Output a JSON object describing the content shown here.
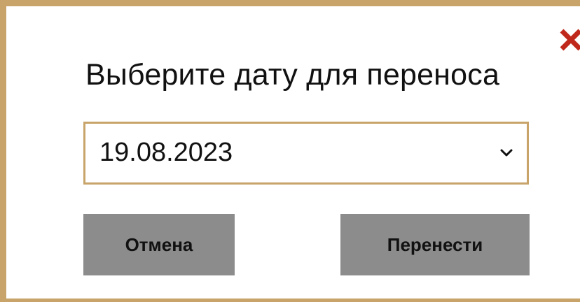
{
  "dialog": {
    "title": "Выберите дату для переноса",
    "close_icon": "close-x-icon",
    "close_color": "#c0281c",
    "date_select": {
      "selected_value": "19.08.2023",
      "dropdown_icon": "chevron-down-icon"
    },
    "buttons": {
      "cancel_label": "Отмена",
      "confirm_label": "Перенести"
    },
    "colors": {
      "border_accent": "#c8a46a",
      "button_bg": "#8c8c8c"
    }
  }
}
